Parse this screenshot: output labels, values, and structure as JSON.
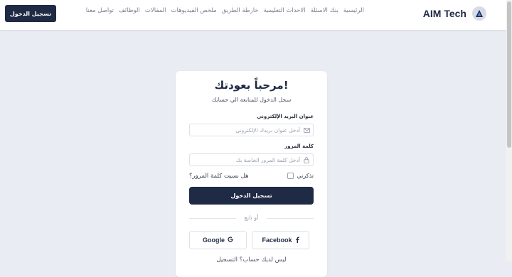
{
  "header": {
    "login_button": "تسجيل الدخول",
    "brand": "AIM Tech",
    "nav": [
      "الرئيسية",
      "بنك الاسئلة",
      "الاحداث التعليمية",
      "خارطة الطريق",
      "ملخص الفيديوهات",
      "المقالات",
      "الوظائف",
      "تواصل معنا"
    ]
  },
  "login": {
    "title": "مرحباً بعودتك!",
    "subtitle": "سجل الدخول للمتابعة الي حسابك",
    "email_label": "عنوان البريد الإلكتروني",
    "email_placeholder": "أدخل عنوان بريدك الإلكتروني",
    "password_label": "كلمة المرور",
    "password_placeholder": "أدخل كلمة المرور الخاصة بك",
    "remember_label": "تذكرني",
    "forgot_link": "هل نسيت كلمة المرور؟",
    "submit_label": "تسجيل الدخول",
    "divider": "أو تابع",
    "google_label": "Google",
    "facebook_label": "Facebook",
    "signup_text": "ليس لديك حساب؟ التسجيل"
  },
  "colors": {
    "primary": "#1f2a44",
    "background": "#e9ecf2"
  }
}
